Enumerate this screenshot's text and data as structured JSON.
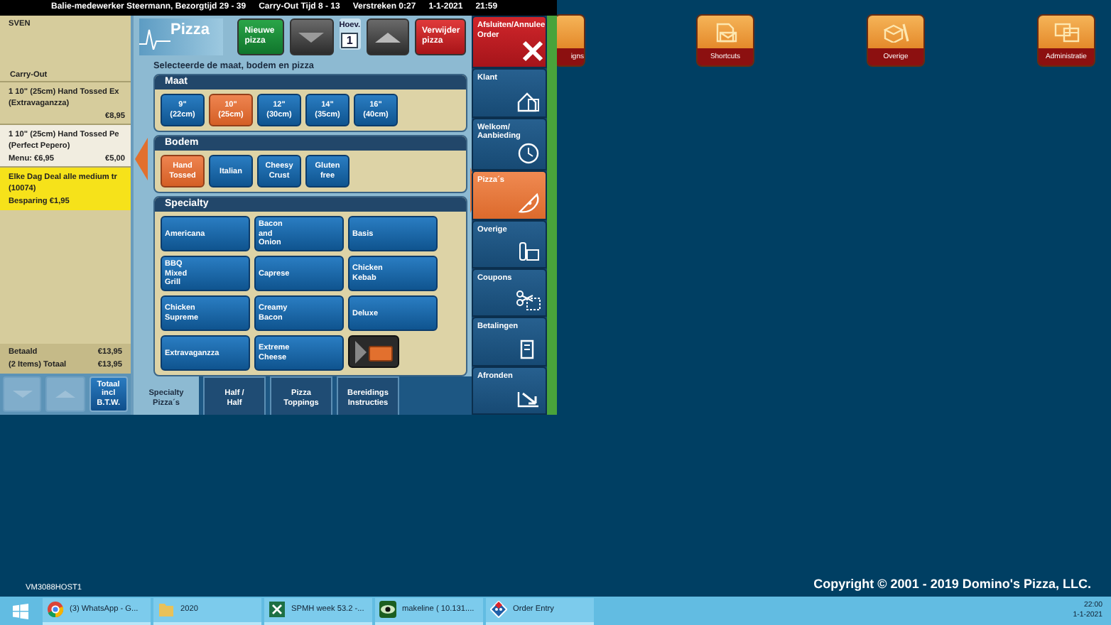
{
  "status_bar": [
    "Balie-medewerker Steermann, Bezorgtijd 29 - 39",
    "Carry-Out Tijd 8 - 13",
    "Verstreken 0:27",
    "1-1-2021",
    "21:59"
  ],
  "order_panel": {
    "customer": "SVEN",
    "order_type": "Carry-Out",
    "lines": [
      {
        "kind": "item",
        "selected": false,
        "title": "1 10\" (25cm) Hand Tossed Ex",
        "subtitle": "(Extravaganzza)",
        "price": "€8,95"
      },
      {
        "kind": "item",
        "selected": true,
        "title": "1 10\" (25cm) Hand Tossed Pe",
        "subtitle": "(Perfect Pepero)",
        "note": "Menu: €6,95",
        "price": "€5,00"
      },
      {
        "kind": "deal",
        "selected": false,
        "title": "Elke Dag Deal alle medium tr",
        "subtitle": "(10074)",
        "note": "Besparing €1,95"
      }
    ],
    "totals": [
      {
        "label": "Betaald",
        "value": "€13,95"
      },
      {
        "label": "(2 Items) Totaal",
        "value": "€13,95"
      }
    ],
    "buttons": [
      {
        "kind": "down",
        "disabled": true
      },
      {
        "kind": "up",
        "disabled": true
      },
      {
        "kind": "text",
        "label": "Totaal\nincl\nB.T.W.",
        "disabled": false
      }
    ]
  },
  "pizza_panel": {
    "title": "Pizza",
    "actions": [
      {
        "kind": "new",
        "label": "Nieuwe\npizza"
      },
      {
        "kind": "down"
      },
      {
        "kind": "quantity",
        "label": "Hoev.",
        "value": "1"
      },
      {
        "kind": "up"
      },
      {
        "kind": "delete",
        "label": "Verwijder\npizza"
      }
    ],
    "instruction": "Selecteerde de maat, bodem en pizza",
    "sections": [
      {
        "title": "Maat",
        "options": [
          {
            "label": "9\"\n(22cm)",
            "selected": false
          },
          {
            "label": "10\"\n(25cm)",
            "selected": true
          },
          {
            "label": "12\"\n(30cm)",
            "selected": false
          },
          {
            "label": "14\"\n(35cm)",
            "selected": false
          },
          {
            "label": "16\"\n(40cm)",
            "selected": false
          }
        ]
      },
      {
        "title": "Bodem",
        "options": [
          {
            "label": "Hand\nTossed",
            "selected": true
          },
          {
            "label": "Italian",
            "selected": false
          },
          {
            "label": "Cheesy\nCrust",
            "selected": false
          },
          {
            "label": "Gluten\nfree",
            "selected": false
          }
        ]
      },
      {
        "title": "Specialty",
        "options": [
          {
            "label": "Americana",
            "selected": false
          },
          {
            "label": "Bacon\nand\nOnion",
            "selected": false
          },
          {
            "label": "Basis",
            "selected": false
          },
          {
            "label": "BBQ\nMixed\nGrill",
            "selected": false
          },
          {
            "label": "Caprese",
            "selected": false
          },
          {
            "label": "Chicken\nKebab",
            "selected": false
          },
          {
            "label": "Chicken\nSupreme",
            "selected": false
          },
          {
            "label": "Creamy\nBacon",
            "selected": false
          },
          {
            "label": "Deluxe",
            "selected": false
          },
          {
            "label": "Extravaganzza",
            "selected": false
          },
          {
            "label": "Extreme\nCheese",
            "selected": false
          },
          {
            "kind": "next"
          }
        ]
      }
    ],
    "tabs": [
      {
        "label": "Specialty\nPizza´s",
        "selected": true
      },
      {
        "label": "Half /\nHalf",
        "selected": false
      },
      {
        "label": "Pizza\nToppings",
        "selected": false
      },
      {
        "label": "Bereidings\nInstructies",
        "selected": false
      }
    ]
  },
  "navigation": [
    {
      "kind": "close",
      "label": "Afsluiten/Annulee\nOrder",
      "selected": false
    },
    {
      "kind": "customer",
      "label": "Klant",
      "selected": false
    },
    {
      "kind": "welcome",
      "label": "Welkom/\nAanbieding",
      "selected": false
    },
    {
      "kind": "pizza",
      "label": "Pizza´s",
      "selected": true
    },
    {
      "kind": "other",
      "label": "Overige",
      "selected": false
    },
    {
      "kind": "coupon",
      "label": "Coupons",
      "selected": false
    },
    {
      "kind": "payment",
      "label": "Betalingen",
      "selected": false
    },
    {
      "kind": "finish",
      "label": "Afronden",
      "selected": false
    }
  ],
  "desktop_icons": [
    {
      "kind": "partial",
      "label": "igns"
    },
    {
      "kind": "shortcuts",
      "label": "Shortcuts"
    },
    {
      "kind": "other",
      "label": "Overige"
    },
    {
      "kind": "admin",
      "label": "Administratie"
    }
  ],
  "host_label": "VM3088HOST1",
  "copyright": "Copyright © 2001 - 2019  Domino's Pizza, LLC.",
  "taskbar": {
    "items": [
      {
        "kind": "browser",
        "label": "(3) WhatsApp - G..."
      },
      {
        "kind": "folder",
        "label": "2020"
      },
      {
        "kind": "spreadsheet",
        "label": "SPMH week 53.2 -..."
      },
      {
        "kind": "viewer",
        "label": "makeline ( 10.131...."
      },
      {
        "kind": "pos",
        "label": "Order Entry"
      }
    ],
    "clock": {
      "time": "22:00",
      "date": "1-1-2021"
    }
  }
}
